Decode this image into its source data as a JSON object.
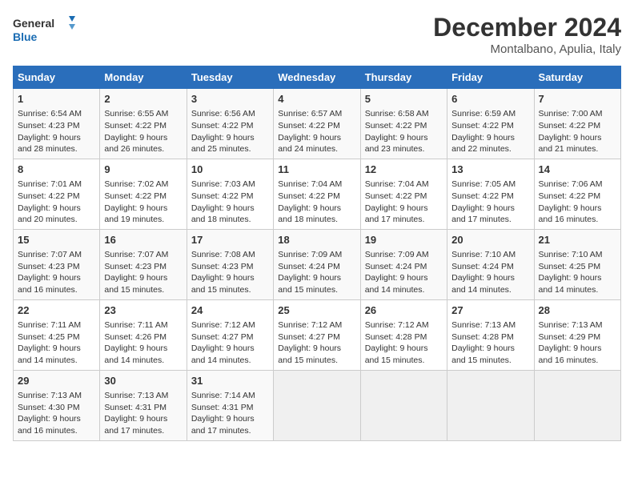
{
  "header": {
    "logo_line1": "General",
    "logo_line2": "Blue",
    "month": "December 2024",
    "location": "Montalbano, Apulia, Italy"
  },
  "days_of_week": [
    "Sunday",
    "Monday",
    "Tuesday",
    "Wednesday",
    "Thursday",
    "Friday",
    "Saturday"
  ],
  "weeks": [
    [
      {
        "day": "1",
        "info": "Sunrise: 6:54 AM\nSunset: 4:23 PM\nDaylight: 9 hours\nand 28 minutes."
      },
      {
        "day": "2",
        "info": "Sunrise: 6:55 AM\nSunset: 4:22 PM\nDaylight: 9 hours\nand 26 minutes."
      },
      {
        "day": "3",
        "info": "Sunrise: 6:56 AM\nSunset: 4:22 PM\nDaylight: 9 hours\nand 25 minutes."
      },
      {
        "day": "4",
        "info": "Sunrise: 6:57 AM\nSunset: 4:22 PM\nDaylight: 9 hours\nand 24 minutes."
      },
      {
        "day": "5",
        "info": "Sunrise: 6:58 AM\nSunset: 4:22 PM\nDaylight: 9 hours\nand 23 minutes."
      },
      {
        "day": "6",
        "info": "Sunrise: 6:59 AM\nSunset: 4:22 PM\nDaylight: 9 hours\nand 22 minutes."
      },
      {
        "day": "7",
        "info": "Sunrise: 7:00 AM\nSunset: 4:22 PM\nDaylight: 9 hours\nand 21 minutes."
      }
    ],
    [
      {
        "day": "8",
        "info": "Sunrise: 7:01 AM\nSunset: 4:22 PM\nDaylight: 9 hours\nand 20 minutes."
      },
      {
        "day": "9",
        "info": "Sunrise: 7:02 AM\nSunset: 4:22 PM\nDaylight: 9 hours\nand 19 minutes."
      },
      {
        "day": "10",
        "info": "Sunrise: 7:03 AM\nSunset: 4:22 PM\nDaylight: 9 hours\nand 18 minutes."
      },
      {
        "day": "11",
        "info": "Sunrise: 7:04 AM\nSunset: 4:22 PM\nDaylight: 9 hours\nand 18 minutes."
      },
      {
        "day": "12",
        "info": "Sunrise: 7:04 AM\nSunset: 4:22 PM\nDaylight: 9 hours\nand 17 minutes."
      },
      {
        "day": "13",
        "info": "Sunrise: 7:05 AM\nSunset: 4:22 PM\nDaylight: 9 hours\nand 17 minutes."
      },
      {
        "day": "14",
        "info": "Sunrise: 7:06 AM\nSunset: 4:22 PM\nDaylight: 9 hours\nand 16 minutes."
      }
    ],
    [
      {
        "day": "15",
        "info": "Sunrise: 7:07 AM\nSunset: 4:23 PM\nDaylight: 9 hours\nand 16 minutes."
      },
      {
        "day": "16",
        "info": "Sunrise: 7:07 AM\nSunset: 4:23 PM\nDaylight: 9 hours\nand 15 minutes."
      },
      {
        "day": "17",
        "info": "Sunrise: 7:08 AM\nSunset: 4:23 PM\nDaylight: 9 hours\nand 15 minutes."
      },
      {
        "day": "18",
        "info": "Sunrise: 7:09 AM\nSunset: 4:24 PM\nDaylight: 9 hours\nand 15 minutes."
      },
      {
        "day": "19",
        "info": "Sunrise: 7:09 AM\nSunset: 4:24 PM\nDaylight: 9 hours\nand 14 minutes."
      },
      {
        "day": "20",
        "info": "Sunrise: 7:10 AM\nSunset: 4:24 PM\nDaylight: 9 hours\nand 14 minutes."
      },
      {
        "day": "21",
        "info": "Sunrise: 7:10 AM\nSunset: 4:25 PM\nDaylight: 9 hours\nand 14 minutes."
      }
    ],
    [
      {
        "day": "22",
        "info": "Sunrise: 7:11 AM\nSunset: 4:25 PM\nDaylight: 9 hours\nand 14 minutes."
      },
      {
        "day": "23",
        "info": "Sunrise: 7:11 AM\nSunset: 4:26 PM\nDaylight: 9 hours\nand 14 minutes."
      },
      {
        "day": "24",
        "info": "Sunrise: 7:12 AM\nSunset: 4:27 PM\nDaylight: 9 hours\nand 14 minutes."
      },
      {
        "day": "25",
        "info": "Sunrise: 7:12 AM\nSunset: 4:27 PM\nDaylight: 9 hours\nand 15 minutes."
      },
      {
        "day": "26",
        "info": "Sunrise: 7:12 AM\nSunset: 4:28 PM\nDaylight: 9 hours\nand 15 minutes."
      },
      {
        "day": "27",
        "info": "Sunrise: 7:13 AM\nSunset: 4:28 PM\nDaylight: 9 hours\nand 15 minutes."
      },
      {
        "day": "28",
        "info": "Sunrise: 7:13 AM\nSunset: 4:29 PM\nDaylight: 9 hours\nand 16 minutes."
      }
    ],
    [
      {
        "day": "29",
        "info": "Sunrise: 7:13 AM\nSunset: 4:30 PM\nDaylight: 9 hours\nand 16 minutes."
      },
      {
        "day": "30",
        "info": "Sunrise: 7:13 AM\nSunset: 4:31 PM\nDaylight: 9 hours\nand 17 minutes."
      },
      {
        "day": "31",
        "info": "Sunrise: 7:14 AM\nSunset: 4:31 PM\nDaylight: 9 hours\nand 17 minutes."
      },
      {
        "day": "",
        "info": ""
      },
      {
        "day": "",
        "info": ""
      },
      {
        "day": "",
        "info": ""
      },
      {
        "day": "",
        "info": ""
      }
    ]
  ]
}
